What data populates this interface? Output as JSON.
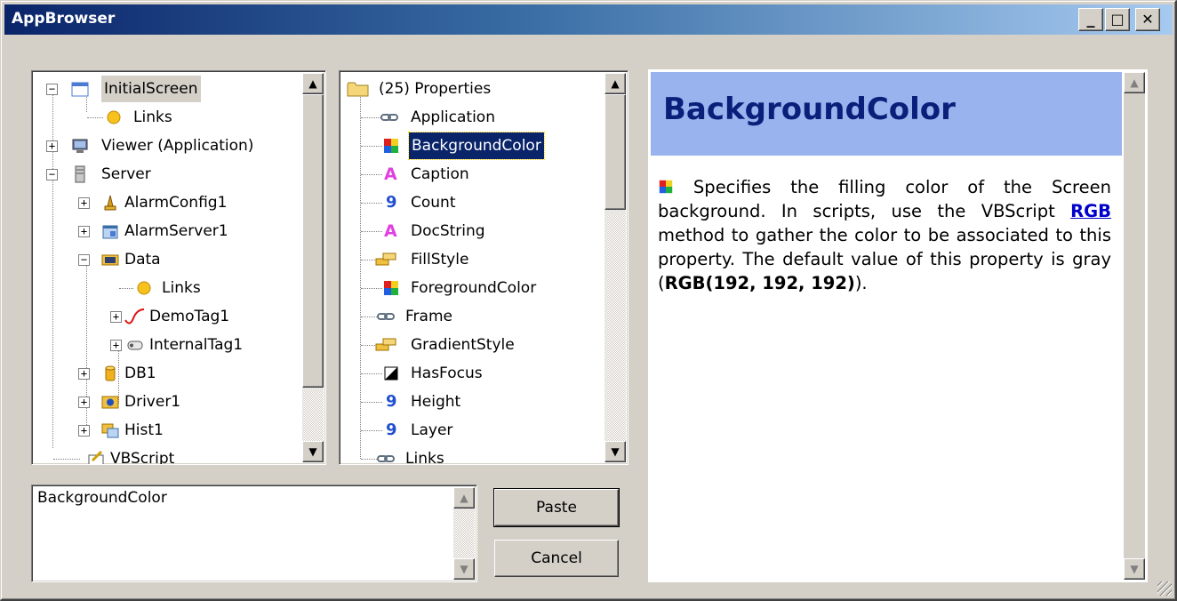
{
  "window": {
    "title": "AppBrowser",
    "controls": {
      "minimize": "_",
      "maximize": "□",
      "close": "✕"
    }
  },
  "tree": {
    "items": [
      {
        "label": "InitialScreen",
        "icon": "screen-icon",
        "expander": "−",
        "selected": true
      },
      {
        "label": "Links",
        "icon": "link-dot-icon"
      },
      {
        "label": "Viewer (Application)",
        "icon": "viewer-icon",
        "expander": "+"
      },
      {
        "label": "Server",
        "icon": "server-icon",
        "expander": "−"
      },
      {
        "label": "AlarmConfig1",
        "icon": "alarm-bell-icon",
        "expander": "+"
      },
      {
        "label": "AlarmServer1",
        "icon": "alarm-server-icon",
        "expander": "+"
      },
      {
        "label": "Data",
        "icon": "data-icon",
        "expander": "−"
      },
      {
        "label": "Links",
        "icon": "link-dot-icon"
      },
      {
        "label": "DemoTag1",
        "icon": "wave-icon",
        "expander": "+"
      },
      {
        "label": "InternalTag1",
        "icon": "tag-icon",
        "expander": "+"
      },
      {
        "label": "DB1",
        "icon": "database-icon",
        "expander": "+"
      },
      {
        "label": "Driver1",
        "icon": "driver-icon",
        "expander": "+"
      },
      {
        "label": "Hist1",
        "icon": "history-icon",
        "expander": "+"
      },
      {
        "label": "VBScript",
        "icon": "script-icon"
      }
    ]
  },
  "properties": {
    "header": "(25) Properties",
    "items": [
      {
        "label": "Application",
        "icon": "object-link-icon"
      },
      {
        "label": "BackgroundColor",
        "icon": "color-icon",
        "selected": true
      },
      {
        "label": "Caption",
        "icon": "text-a-icon"
      },
      {
        "label": "Count",
        "icon": "number-icon"
      },
      {
        "label": "DocString",
        "icon": "text-a-icon"
      },
      {
        "label": "FillStyle",
        "icon": "enum-icon"
      },
      {
        "label": "ForegroundColor",
        "icon": "color-icon"
      },
      {
        "label": "Frame",
        "icon": "object-link-icon"
      },
      {
        "label": "GradientStyle",
        "icon": "enum-icon"
      },
      {
        "label": "HasFocus",
        "icon": "boolean-icon"
      },
      {
        "label": "Height",
        "icon": "number-icon"
      },
      {
        "label": "Layer",
        "icon": "number-icon"
      },
      {
        "label": "Links",
        "icon": "object-link-icon"
      }
    ]
  },
  "expression": {
    "value": "BackgroundColor"
  },
  "buttons": {
    "paste": "Paste",
    "cancel": "Cancel"
  },
  "help": {
    "title": "BackgroundColor",
    "text_before_link": " Specifies the filling color of the Screen background. In scripts, use the VBScript ",
    "link": "RGB",
    "text_after_link": " method to gather the color to be associated to this property. The default value of this property is gray (",
    "bold_value": "RGB(192, 192, 192)",
    "text_end": ")."
  },
  "colors": {
    "title_gradient_start": "#0a246a",
    "selection_blue": "#0a246a",
    "help_header_bg": "#99b3ee",
    "help_title": "#0a1f7a",
    "link": "#0000cc"
  }
}
